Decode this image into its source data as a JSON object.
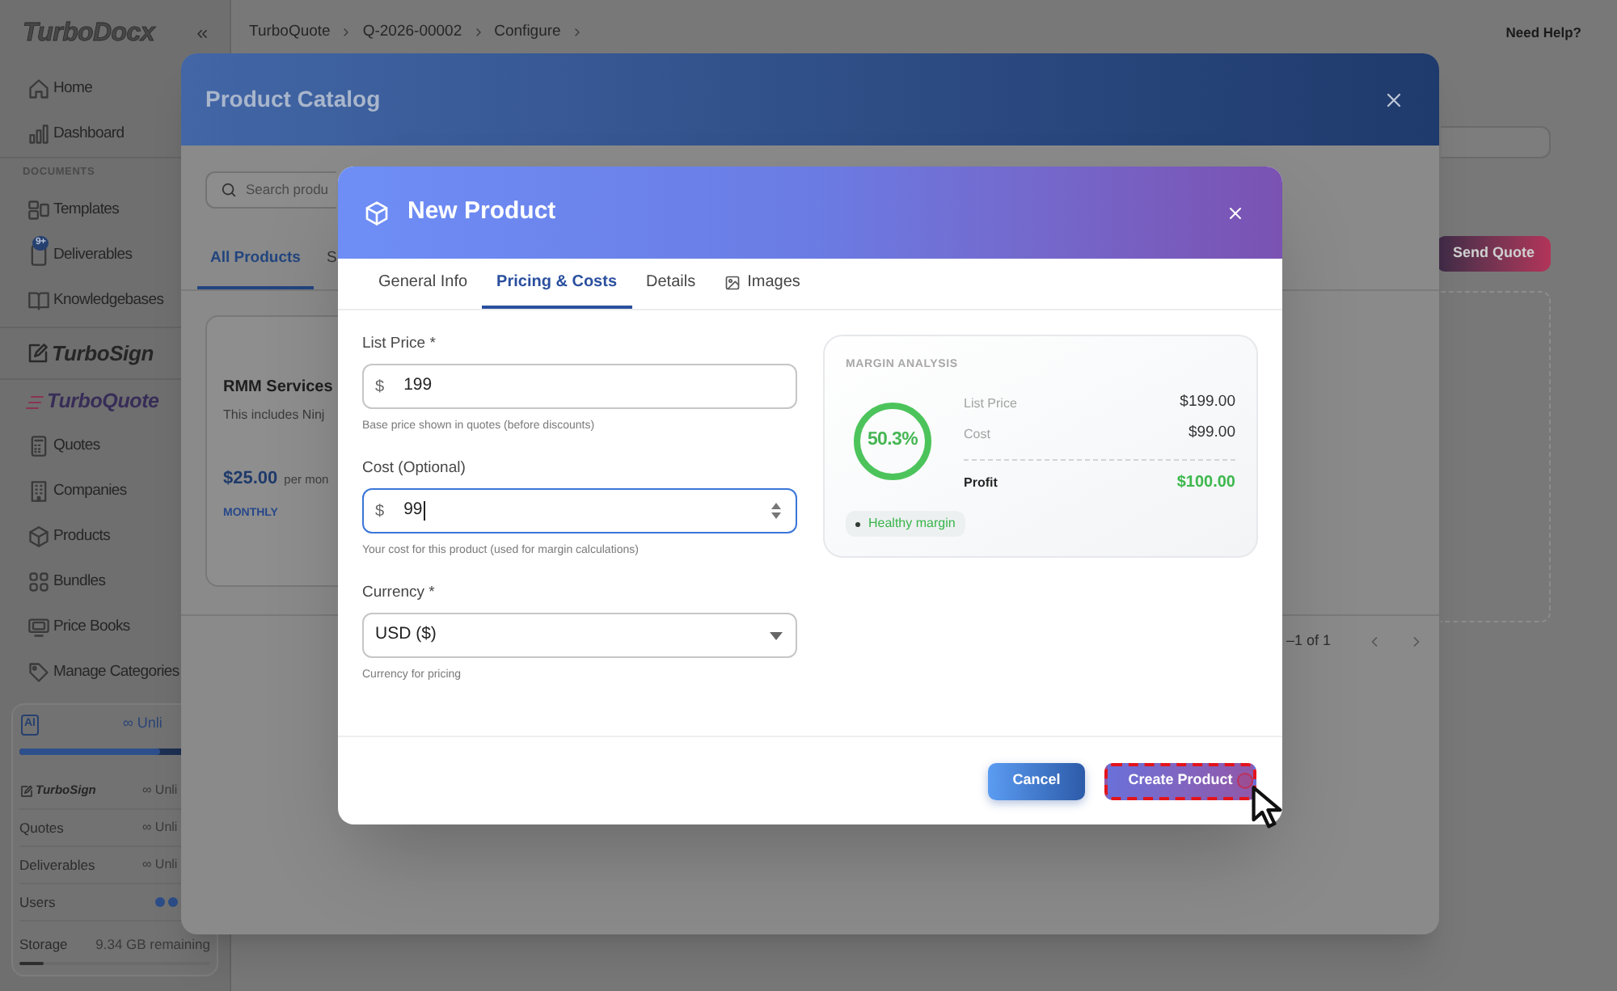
{
  "sidebar": {
    "logo": "TurboDocx",
    "nav": [
      {
        "label": "Home"
      },
      {
        "label": "Dashboard"
      }
    ],
    "documents": {
      "heading": "DOCUMENTS",
      "items": [
        {
          "label": "Templates"
        },
        {
          "label": "Deliverables",
          "badge": "9+"
        },
        {
          "label": "Knowledgebases"
        }
      ]
    },
    "turbosign": {
      "brand": "TurboSign"
    },
    "turboquote": {
      "brand": "TurboQuote",
      "items": [
        {
          "label": "Quotes"
        },
        {
          "label": "Companies"
        },
        {
          "label": "Products"
        },
        {
          "label": "Bundles"
        },
        {
          "label": "Price Books"
        },
        {
          "label": "Manage Categories"
        }
      ]
    },
    "usage": {
      "logo": "AI",
      "limit": "∞ Unli",
      "level": 0.74,
      "rows": [
        {
          "kind": "brand",
          "label": "TurboSign",
          "value": "∞ Unli"
        },
        {
          "kind": "text",
          "label": "Quotes",
          "value": "∞ Unli"
        },
        {
          "kind": "text",
          "label": "Deliverables",
          "value": "∞ Unli"
        },
        {
          "kind": "dots",
          "label": "Users"
        }
      ],
      "storage": {
        "label": "Storage",
        "value": "9.34 GB remaining",
        "level": 0.13
      }
    }
  },
  "topbar": {
    "breadcrumbs": [
      "TurboQuote",
      "Q-2026-00002",
      "Configure"
    ],
    "help": "Need Help?"
  },
  "page": {
    "send_button": "Send Quote"
  },
  "catalog": {
    "title": "Product Catalog",
    "search": {
      "placeholder": "Search produ"
    },
    "tabs": [
      {
        "label": "All Products",
        "selected": true
      },
      {
        "label": "S",
        "selected": false
      }
    ],
    "products": [
      {
        "name": "RMM Services",
        "description": "This includes Ninj",
        "price": "$25.00",
        "period": "per mon",
        "billing": "MONTHLY"
      }
    ],
    "pagination": {
      "range": "–1 of 1"
    }
  },
  "new_product": {
    "title": "New Product",
    "tabs": [
      {
        "kind": "text",
        "label": "General Info",
        "selected": false
      },
      {
        "kind": "text",
        "label": "Pricing & Costs",
        "selected": true
      },
      {
        "kind": "text",
        "label": "Details",
        "selected": false
      },
      {
        "kind": "icon",
        "label": "Images",
        "selected": false
      }
    ],
    "fields": [
      {
        "kind": "money",
        "label": "List Price *",
        "prefix": "$",
        "value": "199",
        "help": "Base price shown in quotes (before discounts)",
        "focused": false
      },
      {
        "kind": "money",
        "label": "Cost (Optional)",
        "prefix": "$",
        "value": "99",
        "help": "Your cost for this product (used for margin calculations)",
        "focused": true
      },
      {
        "kind": "select",
        "label": "Currency *",
        "value": "USD ($)",
        "help": "Currency for pricing",
        "focused": false
      }
    ],
    "margin": {
      "heading": "MARGIN ANALYSIS",
      "percent": "50.3%",
      "rows": [
        {
          "kind": "plain",
          "label": "List Price",
          "value": "$199.00"
        },
        {
          "kind": "plain",
          "label": "Cost",
          "value": "$99.00"
        },
        {
          "kind": "total",
          "label": "Profit",
          "value": "$100.00"
        }
      ],
      "badge": "Healthy margin"
    },
    "buttons": [
      {
        "kind": "secondary",
        "label": "Cancel",
        "highlighted": false,
        "hovered": false
      },
      {
        "kind": "primary",
        "label": "Create Product",
        "highlighted": true,
        "hovered": true
      }
    ]
  }
}
